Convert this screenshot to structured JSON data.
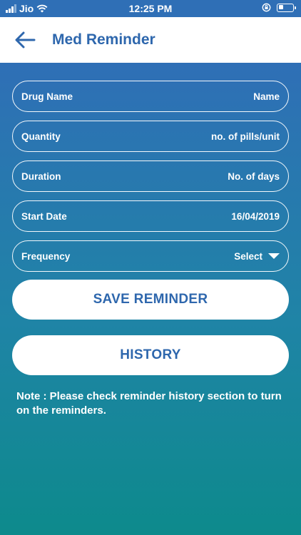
{
  "status_bar": {
    "carrier": "Jio",
    "time": "12:25 PM"
  },
  "header": {
    "title": "Med Reminder",
    "back_icon": "arrow-left-icon"
  },
  "form": {
    "fields": [
      {
        "label": "Drug Name",
        "value": "Name"
      },
      {
        "label": "Quantity",
        "value": "no. of pills/unit"
      },
      {
        "label": "Duration",
        "value": "No. of days"
      },
      {
        "label": "Start Date",
        "value": "16/04/2019"
      },
      {
        "label": "Frequency",
        "value": "Select"
      }
    ]
  },
  "buttons": {
    "save_label": "SAVE REMINDER",
    "history_label": "HISTORY"
  },
  "note": "Note : Please check reminder history  section to turn on the reminders.",
  "colors": {
    "brand_blue": "#2e67ad",
    "gradient_top": "#2f6fb6",
    "gradient_bottom": "#0d8a8c",
    "white": "#ffffff"
  }
}
